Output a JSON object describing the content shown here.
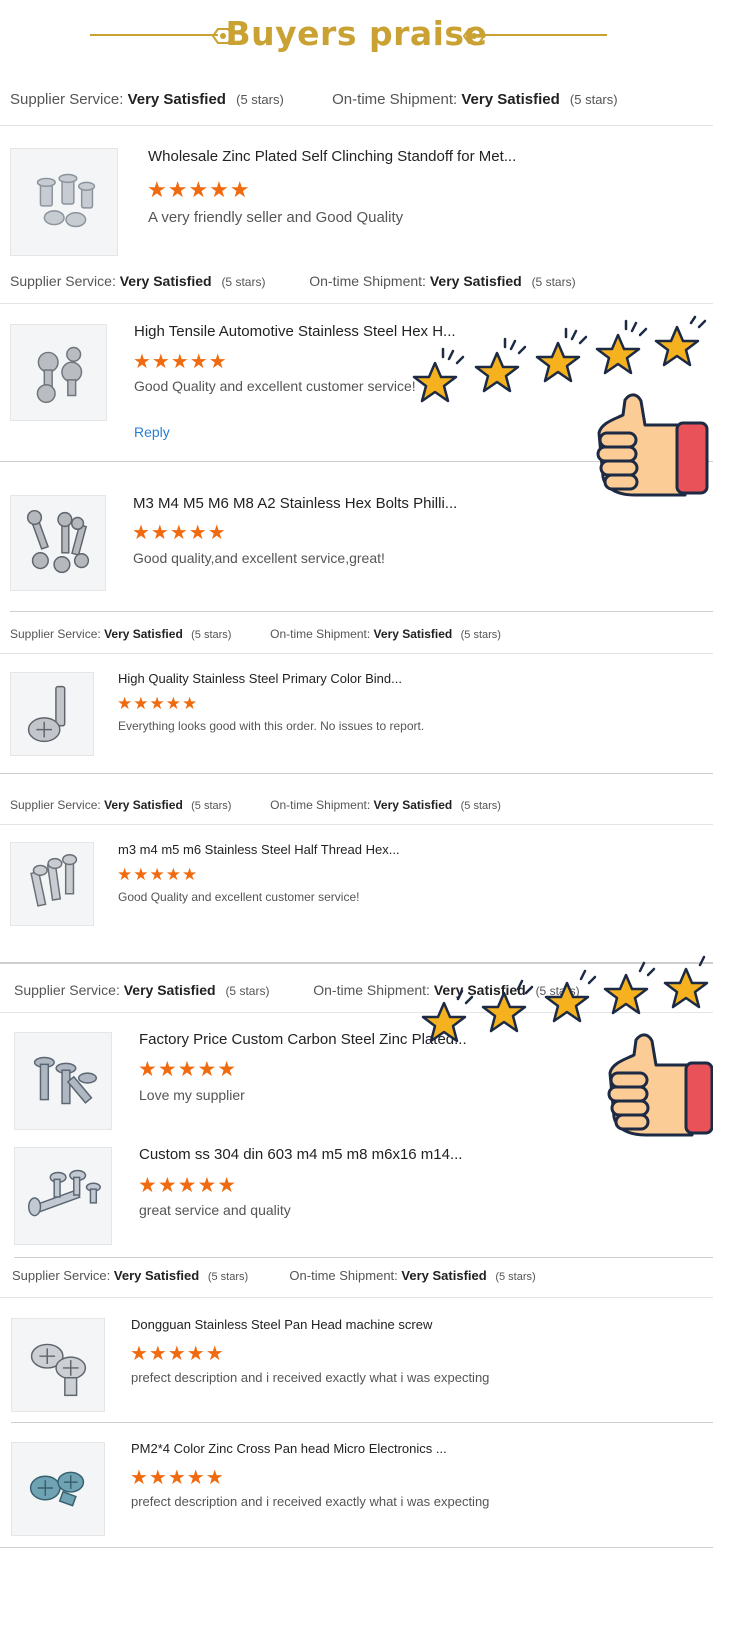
{
  "header": {
    "title": "Buyers praise"
  },
  "colors": {
    "gold": "#c9a233",
    "star_orange": "#f06a10",
    "link_blue": "#2a7fd4"
  },
  "labels": {
    "supplier": "Supplier Service:",
    "shipment": "On-time Shipment:",
    "satisfied": "Very Satisfied",
    "stars_count": "(5 stars)",
    "reply": "Reply"
  },
  "star_glyphs": "★★★★★",
  "reviews": [
    {
      "title": "Wholesale Zinc Plated Self Clinching Standoff for Met...",
      "rating": 5,
      "comment": "A very friendly seller and Good Quality"
    },
    {
      "title": "High Tensile Automotive Stainless Steel Hex H...",
      "rating": 5,
      "comment": "Good Quality and excellent customer service!"
    },
    {
      "title": "M3 M4 M5 M6 M8 A2 Stainless Hex Bolts Philli...",
      "rating": 5,
      "comment": "Good quality,and excellent service,great!"
    },
    {
      "title": "High Quality Stainless Steel Primary Color Bind...",
      "rating": 5,
      "comment": "Everything looks good with this order.  No issues to report."
    },
    {
      "title": "m3 m4 m5 m6 Stainless Steel Half Thread Hex...",
      "rating": 5,
      "comment": "Good Quality and excellent customer service!"
    },
    {
      "title": "Factory Price Custom Carbon Steel Zinc Plated...",
      "rating": 5,
      "comment": "Love my supplier"
    },
    {
      "title": "Custom ss 304 din 603 m4 m5 m8 m6x16 m14...",
      "rating": 5,
      "comment": "great service and quality"
    },
    {
      "title": "Dongguan Stainless Steel Pan Head machine screw",
      "rating": 5,
      "comment": "prefect description and i received exactly what i was expecting"
    },
    {
      "title": "PM2*4 Color Zinc Cross Pan head Micro Electronics ...",
      "rating": 5,
      "comment": "prefect description and i received exactly what i was expecting"
    }
  ],
  "decorations": [
    {
      "name": "five-stars-thumbs-up-illustration",
      "stars": 5
    },
    {
      "name": "five-stars-thumbs-up-illustration",
      "stars": 5
    }
  ]
}
